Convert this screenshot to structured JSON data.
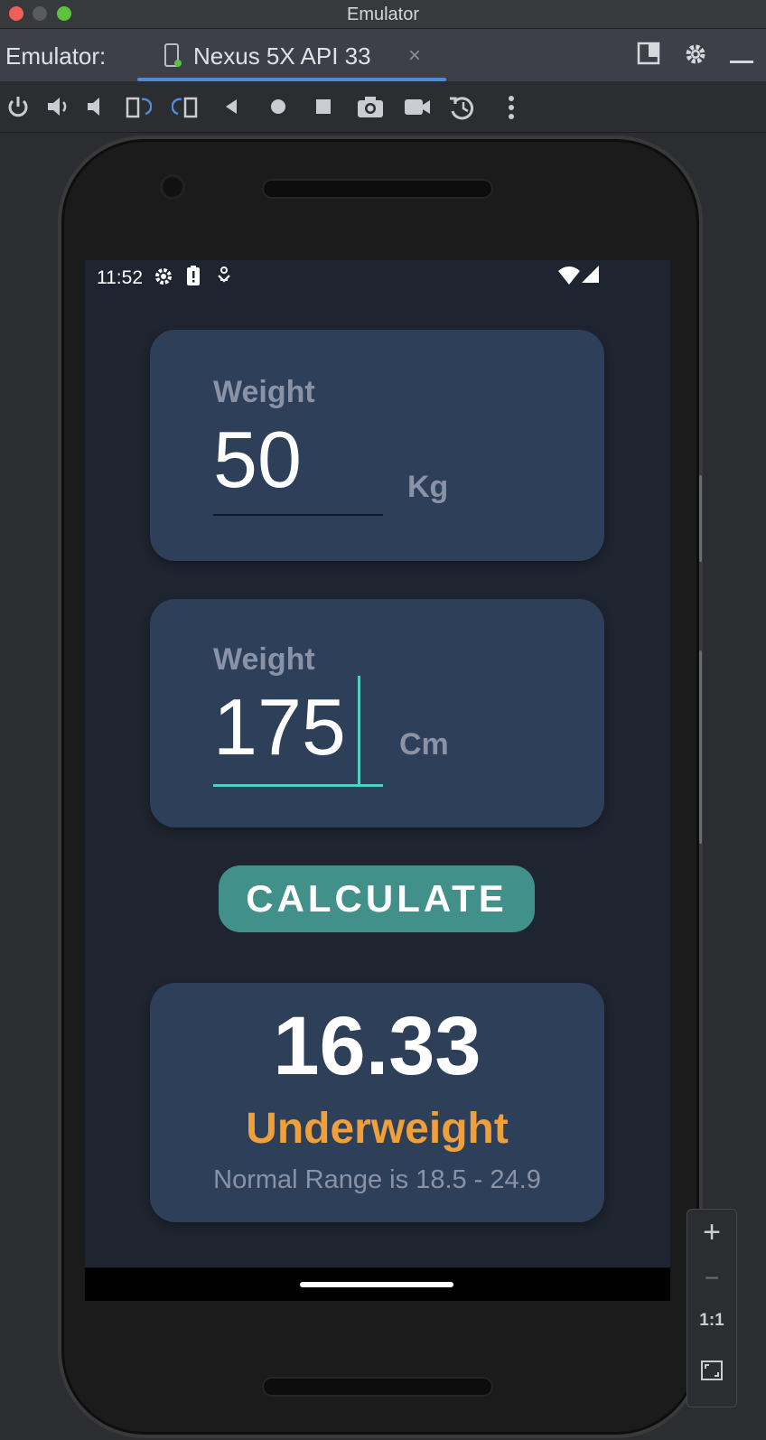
{
  "window": {
    "title": "Emulator"
  },
  "header": {
    "label": "Emulator:",
    "tab": {
      "name": "Nexus 5X API 33",
      "close": "×"
    }
  },
  "toolbar": {
    "icons": [
      "power-icon",
      "volume-up-icon",
      "volume-down-icon",
      "rotate-left-icon",
      "rotate-right-icon",
      "back-icon",
      "home-icon",
      "overview-icon",
      "screenshot-icon",
      "record-icon",
      "snapshot-icon",
      "more-icon"
    ]
  },
  "statusbar": {
    "time": "11:52"
  },
  "weight_card": {
    "label": "Weight",
    "value": "50",
    "unit": "Kg"
  },
  "height_card": {
    "label": "Weight",
    "value": "175",
    "unit": "Cm"
  },
  "calculate": {
    "label": "CALCULATE"
  },
  "result": {
    "value": "16.33",
    "category": "Underweight",
    "range": "Normal Range is 18.5 - 24.9"
  },
  "zoom": {
    "in": "+",
    "out": "−",
    "actual": "1:1"
  },
  "colors": {
    "accent_teal": "#41918a",
    "cursor_teal": "#4fd1c1",
    "underweight_orange": "#f0a03a",
    "card_bg": "#2e3f5a",
    "screen_bg": "#1f2530"
  }
}
